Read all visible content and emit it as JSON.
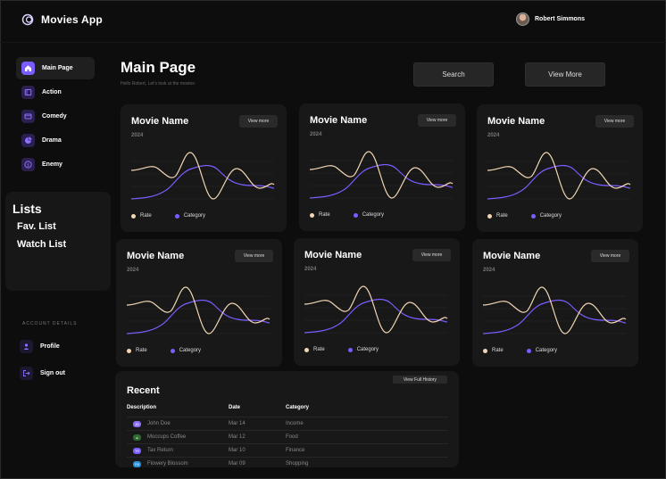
{
  "app": {
    "title": "Movies App"
  },
  "user": {
    "name": "Robert Simmons"
  },
  "sidebar": {
    "items": [
      {
        "label": "Main Page",
        "icon": "home-icon"
      },
      {
        "label": "Action",
        "icon": "film-icon"
      },
      {
        "label": "Comedy",
        "icon": "card-icon"
      },
      {
        "label": "Drama",
        "icon": "pie-icon"
      },
      {
        "label": "Enemy",
        "icon": "dollar-icon"
      }
    ],
    "lists": {
      "title": "Lists",
      "items": [
        "Fav. List",
        "Watch List"
      ]
    },
    "account": {
      "title": "ACCOUNT DETAILS",
      "items": [
        {
          "label": "Profile",
          "icon": "user-icon"
        },
        {
          "label": "Sign out",
          "icon": "sign-out-icon"
        }
      ]
    }
  },
  "main": {
    "title": "Main Page",
    "subtitle": "Hello Robert, Let's look at the movies:",
    "search_label": "Search",
    "view_more_label": "View More"
  },
  "cards": [
    {
      "name": "Movie Name",
      "year": "2024",
      "button": "View more"
    },
    {
      "name": "Movie Name",
      "year": "2024",
      "button": "View more"
    },
    {
      "name": "Movie Name",
      "year": "2024",
      "button": "View more"
    },
    {
      "name": "Movie Name",
      "year": "2024",
      "button": "View more"
    },
    {
      "name": "Movie Name",
      "year": "2024",
      "button": "View more"
    },
    {
      "name": "Movie Name",
      "year": "2024",
      "button": "View more"
    }
  ],
  "legend": {
    "rate": "Rate",
    "category": "Category"
  },
  "colors": {
    "rate": "#f2d6b3",
    "category": "#7b5cff",
    "accent": "#7b5cff"
  },
  "recent": {
    "title": "Recent",
    "button": "View Full History",
    "headers": [
      "Description",
      "Date",
      "Category"
    ],
    "rows": [
      {
        "icon_text": "JD",
        "icon_color": "#8a6cf0",
        "description": "John Doe",
        "date": "Mar 14",
        "category": "Income"
      },
      {
        "icon_text": "☕",
        "icon_color": "#2d6b2d",
        "description": "Moccups Coffee",
        "date": "Mar 12",
        "category": "Food"
      },
      {
        "icon_text": "TR",
        "icon_color": "#7b5cff",
        "description": "Tax Return",
        "date": "Mar 10",
        "category": "Finance"
      },
      {
        "icon_text": "FB",
        "icon_color": "#2a8fd6",
        "description": "Flowery Blossom",
        "date": "Mar 09",
        "category": "Shopping"
      }
    ]
  }
}
